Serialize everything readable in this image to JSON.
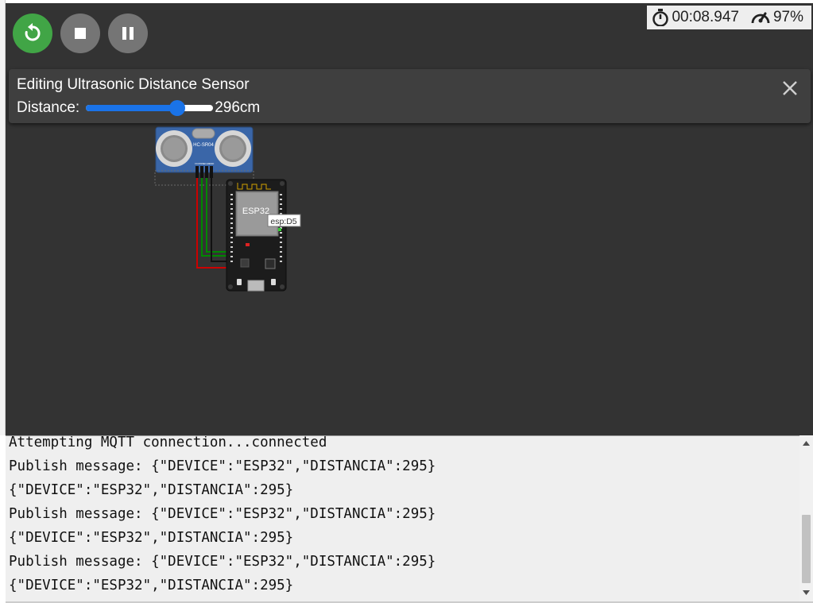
{
  "toolbar": {
    "restart_icon": "restart-icon",
    "stop_icon": "stop-icon",
    "pause_icon": "pause-icon"
  },
  "status": {
    "timer": "00:08.947",
    "speed": "97%"
  },
  "edit_panel": {
    "title": "Editing Ultrasonic Distance Sensor",
    "distance_label": "Distance:",
    "distance_value": "296cm",
    "slider_fraction": 0.72
  },
  "circuit": {
    "sensor_model": "HC-SR04",
    "sensor_pins": [
      "VCC",
      "TRIG",
      "ECHO",
      "GND"
    ],
    "board_label": "ESP32",
    "tooltip": "esp:D5"
  },
  "colors": {
    "canvas": "#333333",
    "restart": "#41a546",
    "control": "#757575",
    "slider": "#1a73e8",
    "wire_vcc": "#cc0000",
    "wire_signal": "#008800",
    "wire_gnd": "#000000"
  },
  "console": {
    "lines": [
      "Attempting MQTT connection...connected",
      "Publish message: {\"DEVICE\":\"ESP32\",\"DISTANCIA\":295}",
      "{\"DEVICE\":\"ESP32\",\"DISTANCIA\":295}",
      "Publish message: {\"DEVICE\":\"ESP32\",\"DISTANCIA\":295}",
      "{\"DEVICE\":\"ESP32\",\"DISTANCIA\":295}",
      "Publish message: {\"DEVICE\":\"ESP32\",\"DISTANCIA\":295}",
      "{\"DEVICE\":\"ESP32\",\"DISTANCIA\":295}"
    ]
  }
}
